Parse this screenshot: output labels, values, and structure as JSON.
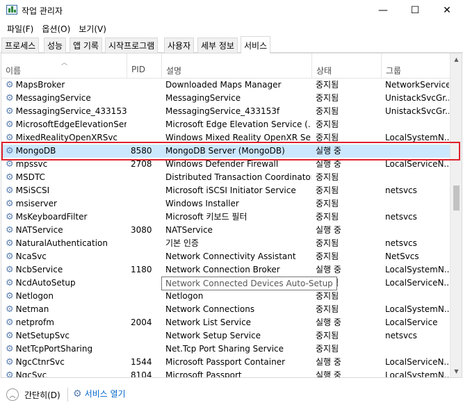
{
  "window": {
    "title": "작업 관리자",
    "minimize": "—",
    "maximize": "☐",
    "close": "✕"
  },
  "menu": [
    "파일(F)",
    "옵션(O)",
    "보기(V)"
  ],
  "tabs": [
    "프로세스",
    "성능",
    "앱 기록",
    "시작프로그램",
    "사용자",
    "세부 정보",
    "서비스"
  ],
  "active_tab": "서비스",
  "columns": {
    "name": "이름",
    "pid": "PID",
    "desc": "설명",
    "status": "상태",
    "group": "그룹"
  },
  "rows": [
    {
      "name": "MapsBroker",
      "pid": "",
      "desc": "Downloaded Maps Manager",
      "status": "중지됨",
      "group": "NetworkService"
    },
    {
      "name": "MessagingService",
      "pid": "",
      "desc": "MessagingService",
      "status": "중지됨",
      "group": "UnistackSvcGr..."
    },
    {
      "name": "MessagingService_433153f",
      "pid": "",
      "desc": "MessagingService_433153f",
      "status": "중지됨",
      "group": "UnistackSvcGr..."
    },
    {
      "name": "MicrosoftEdgeElevationSer...",
      "pid": "",
      "desc": "Microsoft Edge Elevation Service (...",
      "status": "중지됨",
      "group": ""
    },
    {
      "name": "MixedRealityOpenXRSvc",
      "pid": "",
      "desc": "Windows Mixed Reality OpenXR Ser...",
      "status": "중지됨",
      "group": "LocalSystemN..."
    },
    {
      "name": "MongoDB",
      "pid": "8580",
      "desc": "MongoDB Server (MongoDB)",
      "status": "실행 중",
      "group": ""
    },
    {
      "name": "mpssvc",
      "pid": "2708",
      "desc": "Windows Defender Firewall",
      "status": "실행 중",
      "group": "LocalServiceN..."
    },
    {
      "name": "MSDTC",
      "pid": "",
      "desc": "Distributed Transaction Coordinator",
      "status": "중지됨",
      "group": ""
    },
    {
      "name": "MSiSCSI",
      "pid": "",
      "desc": "Microsoft iSCSI Initiator Service",
      "status": "중지됨",
      "group": "netsvcs"
    },
    {
      "name": "msiserver",
      "pid": "",
      "desc": "Windows Installer",
      "status": "중지됨",
      "group": ""
    },
    {
      "name": "MsKeyboardFilter",
      "pid": "",
      "desc": "Microsoft 키보드 필터",
      "status": "중지됨",
      "group": "netsvcs"
    },
    {
      "name": "NATService",
      "pid": "3080",
      "desc": "NATService",
      "status": "실행 중",
      "group": ""
    },
    {
      "name": "NaturalAuthentication",
      "pid": "",
      "desc": "기본 인증",
      "status": "중지됨",
      "group": "netsvcs"
    },
    {
      "name": "NcaSvc",
      "pid": "",
      "desc": "Network Connectivity Assistant",
      "status": "중지됨",
      "group": "NetSvcs"
    },
    {
      "name": "NcbService",
      "pid": "1180",
      "desc": "Network Connection Broker",
      "status": "실행 중",
      "group": "LocalSystemN..."
    },
    {
      "name": "NcdAutoSetup",
      "pid": "",
      "desc": "Network Connected Devices Auto-Setup",
      "status": "중지됨",
      "group": "LocalServiceN..."
    },
    {
      "name": "Netlogon",
      "pid": "",
      "desc": "Netlogon",
      "status": "중지됨",
      "group": ""
    },
    {
      "name": "Netman",
      "pid": "",
      "desc": "Network Connections",
      "status": "중지됨",
      "group": "LocalSystemN..."
    },
    {
      "name": "netprofm",
      "pid": "2004",
      "desc": "Network List Service",
      "status": "실행 중",
      "group": "LocalService"
    },
    {
      "name": "NetSetupSvc",
      "pid": "",
      "desc": "Network Setup Service",
      "status": "중지됨",
      "group": "netsvcs"
    },
    {
      "name": "NetTcpPortSharing",
      "pid": "",
      "desc": "Net.Tcp Port Sharing Service",
      "status": "중지됨",
      "group": ""
    },
    {
      "name": "NgcCtnrSvc",
      "pid": "1544",
      "desc": "Microsoft Passport Container",
      "status": "실행 중",
      "group": "LocalServiceN..."
    },
    {
      "name": "NgcSvc",
      "pid": "8104",
      "desc": "Microsoft Passport",
      "status": "실행 중",
      "group": "LocalSystemN..."
    }
  ],
  "selected_row": "MongoDB",
  "tooltip": "Network Connected Devices Auto-Setup",
  "footer": {
    "collapse_label": "간단히(D)",
    "open_services_label": "서비스 열기"
  },
  "colors": {
    "selection": "#cce8ff",
    "highlight_box": "#e0202a",
    "link": "#0066cc"
  },
  "icons": {
    "service": "gear-icon",
    "app": "task-manager-icon",
    "collapse": "chevron-up-circle-icon"
  }
}
